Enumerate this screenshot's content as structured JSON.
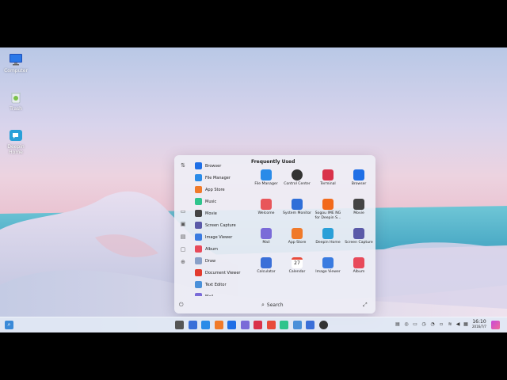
{
  "desktop": {
    "icons": [
      {
        "label": "Computer",
        "icon": "monitor-icon"
      },
      {
        "label": "Trash",
        "icon": "trash-icon"
      },
      {
        "label": "Deepin Home",
        "icon": "deepin-home-icon"
      }
    ]
  },
  "launcher": {
    "section_title": "Frequently Used",
    "search_label": "Search",
    "app_list": [
      {
        "label": "Browser",
        "color": "#1f6fe6"
      },
      {
        "label": "File Manager",
        "color": "#2a8be8"
      },
      {
        "label": "App Store",
        "color": "#f07a2a"
      },
      {
        "label": "Music",
        "color": "#2fc48c"
      },
      {
        "label": "Movie",
        "color": "#444444"
      },
      {
        "label": "Screen Capture",
        "color": "#5a5aa8"
      },
      {
        "label": "Image Viewer",
        "color": "#3a7be0"
      },
      {
        "label": "Album",
        "color": "#e84a5a"
      },
      {
        "label": "Draw",
        "color": "#8aa0c8"
      },
      {
        "label": "Document Viewer",
        "color": "#e23b2e"
      },
      {
        "label": "Text Editor",
        "color": "#4a90d9"
      },
      {
        "label": "Mail",
        "color": "#7a6bd8"
      }
    ],
    "frequent": [
      {
        "label": "File Manager",
        "color": "#2a8be8"
      },
      {
        "label": "Control Center",
        "color": "#333333"
      },
      {
        "label": "Terminal",
        "color": "#d9324a"
      },
      {
        "label": "Browser",
        "color": "#1f6fe6"
      },
      {
        "label": "Welcome",
        "color": "#e8565a"
      },
      {
        "label": "System Monitor",
        "color": "#2f6fd8"
      },
      {
        "label": "Sogou IME NG for Deepin S...",
        "color": "#f26a1b"
      },
      {
        "label": "Movie",
        "color": "#444444"
      },
      {
        "label": "Mail",
        "color": "#7a6bd8"
      },
      {
        "label": "App Store",
        "color": "#f07a2a"
      },
      {
        "label": "Deepin Home",
        "color": "#2aa0d8"
      },
      {
        "label": "Screen Capture",
        "color": "#5a5aa8"
      },
      {
        "label": "Calculator",
        "color": "#3a6fd8"
      },
      {
        "label": "Calendar",
        "color": "#e84a3a"
      },
      {
        "label": "Image Viewer",
        "color": "#3a7be0"
      },
      {
        "label": "Album",
        "color": "#e84a5a"
      }
    ],
    "calendar_day": "27"
  },
  "taskbar": {
    "apps": [
      {
        "name": "launcher",
        "color": "#555555"
      },
      {
        "name": "multitask",
        "color": "#3a6fd8"
      },
      {
        "name": "file-manager",
        "color": "#2a8be8"
      },
      {
        "name": "app-store",
        "color": "#f07a2a"
      },
      {
        "name": "browser",
        "color": "#1f6fe6"
      },
      {
        "name": "mail",
        "color": "#7a6bd8"
      },
      {
        "name": "terminal",
        "color": "#d9324a"
      },
      {
        "name": "calendar",
        "color": "#e84a3a"
      },
      {
        "name": "music",
        "color": "#2fc48c"
      },
      {
        "name": "text-editor",
        "color": "#4a90d9"
      },
      {
        "name": "calculator",
        "color": "#3a6fd8"
      },
      {
        "name": "control-center",
        "color": "#333333"
      }
    ],
    "clock_time": "16:10",
    "clock_date": "2016/7/7"
  }
}
